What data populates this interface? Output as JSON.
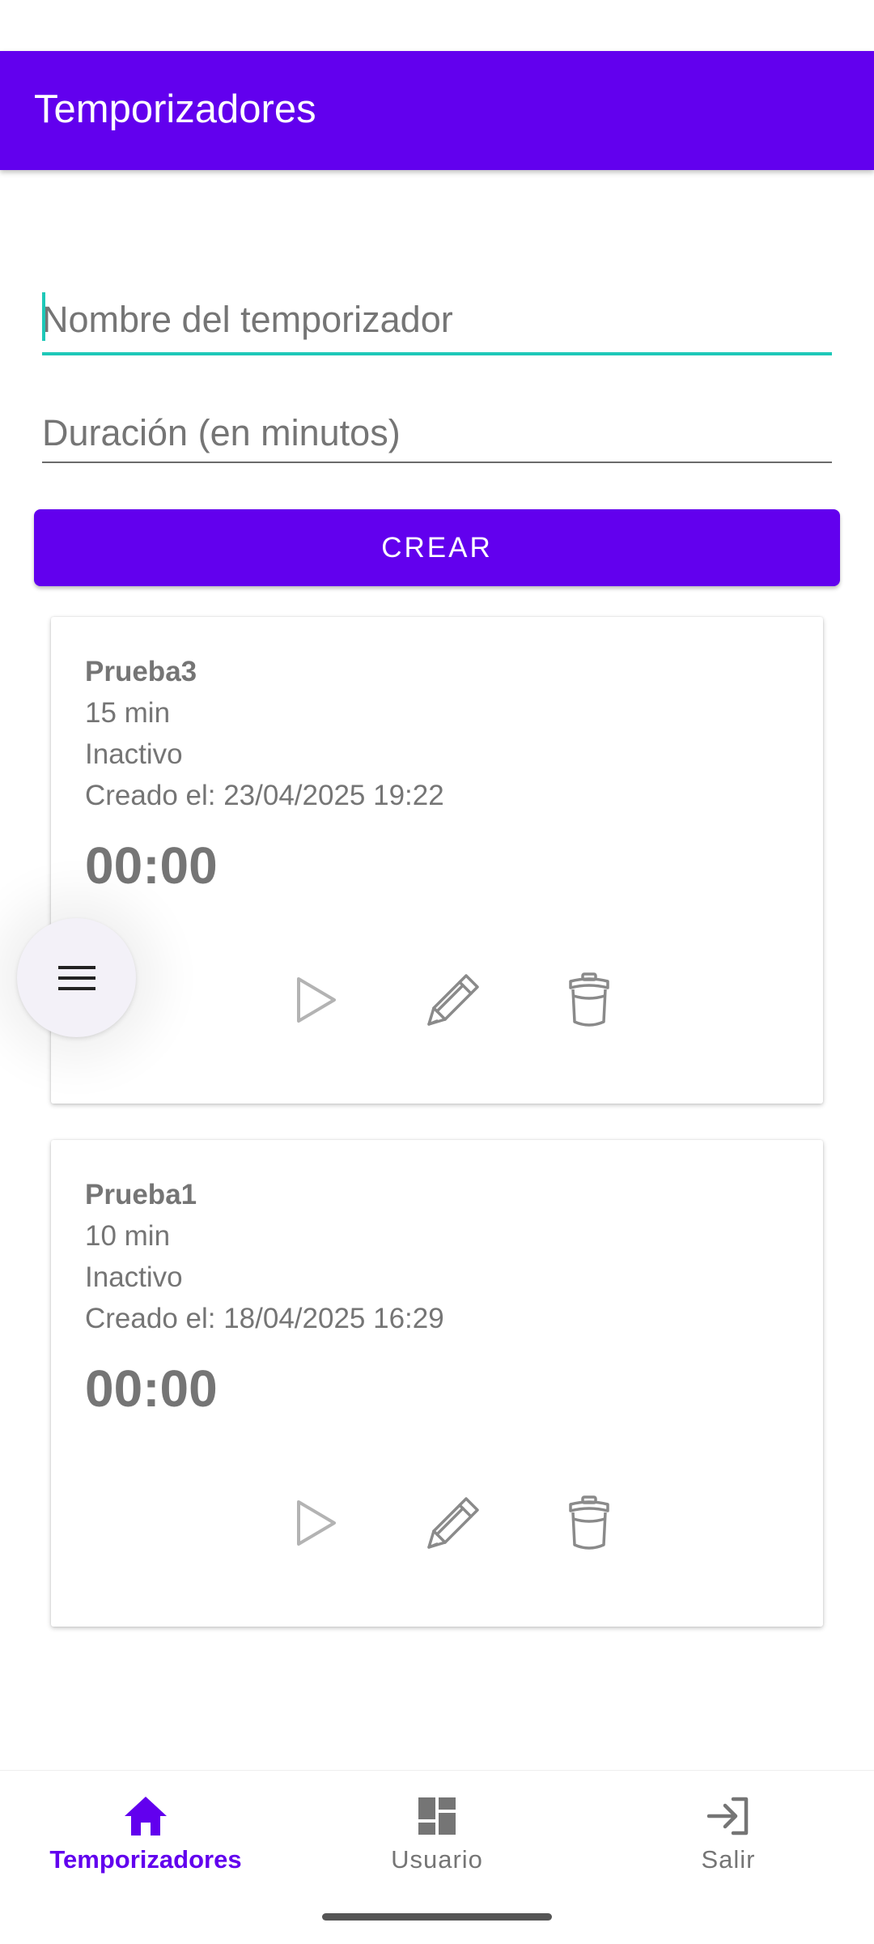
{
  "app_bar": {
    "title": "Temporizadores"
  },
  "form": {
    "name_placeholder": "Nombre del temporizador",
    "duration_placeholder": "Duración (en minutos)",
    "create_label": "CREAR"
  },
  "timers": [
    {
      "name": "Prueba3",
      "duration": "15 min",
      "status": "Inactivo",
      "created": "Creado el: 23/04/2025 19:22",
      "remaining": "00:00"
    },
    {
      "name": "Prueba1",
      "duration": "10 min",
      "status": "Inactivo",
      "created": "Creado el: 18/04/2025 16:29",
      "remaining": "00:00"
    }
  ],
  "icons": {
    "play": "play-icon",
    "edit": "pencil-icon",
    "delete": "trash-icon",
    "menu": "menu-icon"
  },
  "bottom_nav": {
    "items": [
      {
        "label": "Temporizadores",
        "icon": "home-icon",
        "active": true
      },
      {
        "label": "Usuario",
        "icon": "dashboard-icon",
        "active": false
      },
      {
        "label": "Salir",
        "icon": "login-icon",
        "active": false
      }
    ]
  },
  "colors": {
    "primary": "#6200ee",
    "accent": "#1ec8b8",
    "text": "#757575"
  }
}
